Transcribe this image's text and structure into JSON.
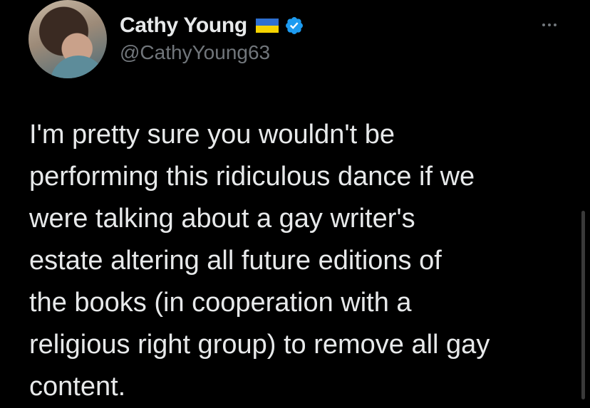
{
  "author": {
    "display_name": "Cathy Young",
    "handle": "@CathyYoung63",
    "flag_icon": "ukraine-flag-icon",
    "verified_icon": "verified-badge-icon",
    "verified_color": "#1d9bf0"
  },
  "tweet": {
    "text": "I'm pretty sure you wouldn't be\nperforming this ridiculous dance if we\nwere talking about a gay writer's\nestate altering all future editions of\nthe books (in cooperation with a\nreligious right group) to remove all gay\ncontent."
  },
  "menu": {
    "icon": "more-options-icon"
  },
  "colors": {
    "background": "#000000",
    "text_primary": "#e7e9ea",
    "text_secondary": "#71767b"
  }
}
